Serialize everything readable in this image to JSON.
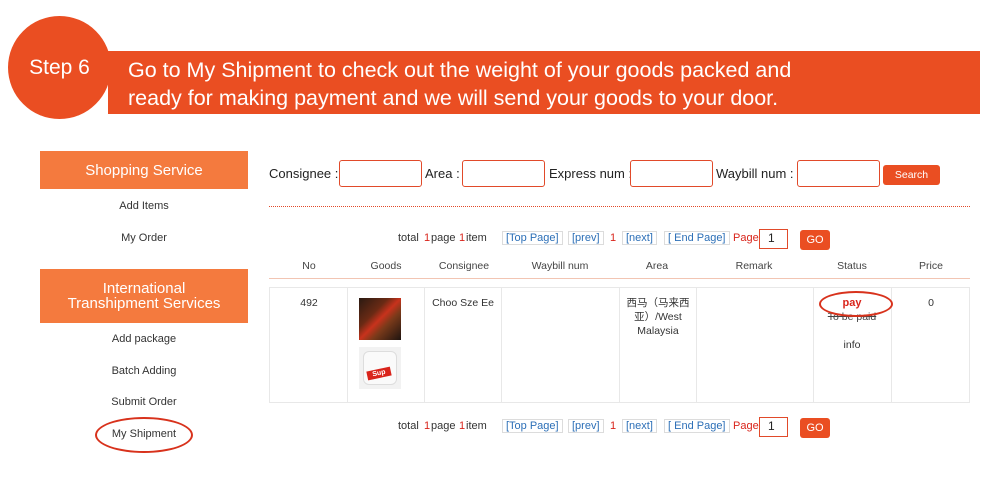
{
  "banner": {
    "step": "Step 6",
    "line1": "Go to My Shipment to check out the weight of your goods packed and",
    "line2": "ready for making payment and we will send your goods to your door."
  },
  "sidebar": {
    "shopping_header": "Shopping Service",
    "shopping_items": [
      "Add Items",
      "My Order"
    ],
    "intl_header_line1": "International",
    "intl_header_line2": "Transhipment Services",
    "intl_items": [
      "Add package",
      "Batch Adding",
      "Submit Order",
      "My Shipment"
    ]
  },
  "filters": {
    "consignee_label": "Consignee :",
    "area_label": "Area :",
    "express_label": "Express num :",
    "waybill_label": "Waybill num :",
    "search_label": "Search"
  },
  "pager": {
    "total_prefix": "total",
    "total_count": "1",
    "page_word": "page",
    "page_count": "1",
    "item_word": "item",
    "top_page": "[Top Page]",
    "prev": "[prev]",
    "current": "1",
    "next": "[next]",
    "end_page": "[ End Page]",
    "page_label": "Page",
    "page_input": "1",
    "go_label": "GO"
  },
  "table": {
    "headers": [
      "No",
      "Goods",
      "Consignee",
      "Waybill num",
      "Area",
      "Remark",
      "Status",
      "Price"
    ],
    "row": {
      "no": "492",
      "consignee": "Choo Sze Ee",
      "waybill": "",
      "area_line1": "西马（马来西",
      "area_line2": "亚）/West",
      "area_line3": "Malaysia",
      "remark": "",
      "status_pay": "pay",
      "status_text": "To be paid",
      "status_info": "info",
      "price": "0"
    }
  },
  "colors": {
    "accent": "#ea4e22",
    "sidebar_header": "#f47a3e",
    "highlight_ring": "#d8321c",
    "link": "#2c6fb7"
  }
}
